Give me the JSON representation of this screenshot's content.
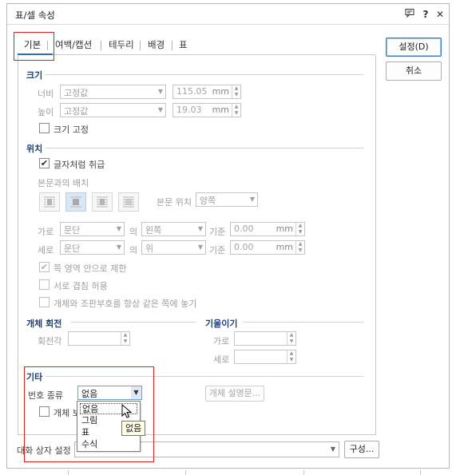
{
  "window": {
    "title": "표/셀 속성",
    "icons": [
      "message-icon",
      "help-icon",
      "close-icon"
    ],
    "help_glyph": "?",
    "close_glyph": "✕"
  },
  "tabs": [
    {
      "label": "기본",
      "active": true
    },
    {
      "label": "여백/캡션",
      "active": false
    },
    {
      "label": "테두리",
      "active": false
    },
    {
      "label": "배경",
      "active": false
    },
    {
      "label": "표",
      "active": false
    }
  ],
  "buttons": {
    "ok": "설정(D)",
    "cancel": "취소",
    "object_desc": "개체 설명문...",
    "compose": "구성..."
  },
  "size": {
    "section": "크기",
    "width_label": "너비",
    "width_mode": "고정값",
    "width_value": "115.05",
    "height_label": "높이",
    "height_mode": "고정값",
    "height_value": "19.03",
    "unit": "mm",
    "lock_label": "크기 고정"
  },
  "position": {
    "section": "위치",
    "treat_as_char": "글자처럼 취급",
    "body_arrange": "본문과의 배치",
    "body_pos_label": "본문 위치",
    "body_pos_value": "양쪽",
    "h_label": "가로",
    "h_ref": "문단",
    "of": "의",
    "h_dir": "왼쪽",
    "base": "기준",
    "h_value": "0.00",
    "v_label": "세로",
    "v_ref": "문단",
    "v_dir": "위",
    "v_value": "0.00",
    "unit": "mm",
    "opt1": "쪽 영역 안으로 제한",
    "opt2": "서로 겹침 허용",
    "opt3": "개체와 조판부호를 항상 같은 쪽에 놓기"
  },
  "rotation": {
    "section": "개체 회전",
    "angle_label": "회전각",
    "tilt_section": "기울이기",
    "tilt_h": "가로",
    "tilt_v": "세로"
  },
  "other": {
    "section": "기타",
    "num_type_label": "번호 종류",
    "num_type_value": "없음",
    "protect_label": "개체 보",
    "dropdown_items": [
      "없음",
      "그림",
      "표",
      "수식"
    ],
    "tooltip": "없음"
  },
  "footer": {
    "label": "대화 상자 설정"
  },
  "colors": {
    "accent": "#2a6cc7",
    "section_text": "#1e3f7a",
    "highlight_box": "#e02020"
  }
}
